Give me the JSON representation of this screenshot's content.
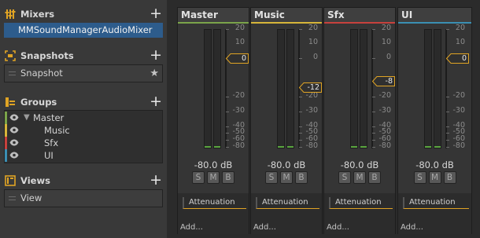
{
  "colors": {
    "selected": "#2d5c8c",
    "master": "#7ba44a",
    "music": "#d7b53a",
    "sfx": "#c7413d",
    "ui": "#3b8fb3",
    "attenuation": "#e0a424",
    "meter": "#5aa53f",
    "section_icon": "#e0a424"
  },
  "mixers": {
    "title": "Mixers",
    "add_icon": "plus-icon",
    "items": [
      "MMSoundManagerAudioMixer"
    ]
  },
  "snapshots": {
    "title": "Snapshots",
    "items": [
      {
        "label": "Snapshot",
        "icon": "star-icon"
      }
    ]
  },
  "groups": {
    "title": "Groups",
    "items": [
      {
        "label": "Master",
        "color": "#7ba44a",
        "expanded": true
      },
      {
        "label": "Music",
        "color": "#d7b53a"
      },
      {
        "label": "Sfx",
        "color": "#c7413d"
      },
      {
        "label": "UI",
        "color": "#3b8fb3"
      }
    ]
  },
  "views": {
    "title": "Views",
    "items": [
      "View"
    ]
  },
  "scale": [
    "20",
    "0",
    "-20",
    "-30",
    "-40",
    "-50",
    "-60",
    "-80"
  ],
  "strip_top_labels": [
    "20",
    "10"
  ],
  "strips": [
    {
      "name": "Master",
      "color": "#7ba44a",
      "handle": "0",
      "db": "-80.0 dB",
      "solo": "S",
      "mute": "M",
      "bypass": "B",
      "effect": "Attenuation",
      "add": "Add..."
    },
    {
      "name": "Music",
      "color": "#d7b53a",
      "handle": "-12",
      "db": "-80.0 dB",
      "solo": "S",
      "mute": "M",
      "bypass": "B",
      "effect": "Attenuation",
      "add": "Add..."
    },
    {
      "name": "Sfx",
      "color": "#c7413d",
      "handle": "-8",
      "db": "-80.0 dB",
      "solo": "S",
      "mute": "M",
      "bypass": "B",
      "effect": "Attenuation",
      "add": "Add..."
    },
    {
      "name": "UI",
      "color": "#3b8fb3",
      "handle": "0",
      "db": "-80.0 dB",
      "solo": "S",
      "mute": "M",
      "bypass": "B",
      "effect": "Attenuation",
      "add": "Add..."
    }
  ]
}
